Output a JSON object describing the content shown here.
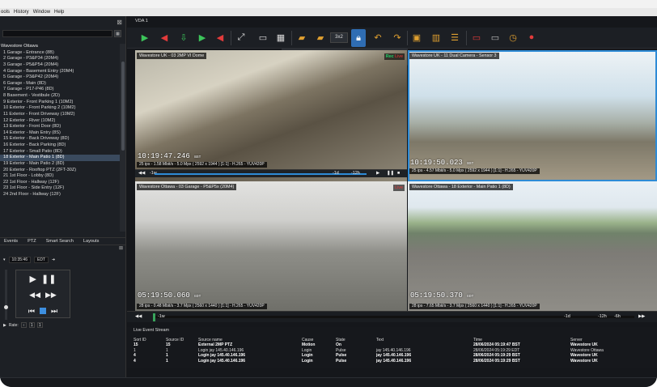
{
  "app": {
    "menu": [
      "ools",
      "History",
      "Window",
      "Help"
    ]
  },
  "left_panel": {
    "close_glyph": "⊠",
    "tree": {
      "root": "Wavestore Ottawa",
      "items": [
        "1 Garage - Entrance (8B)",
        "2 Garage - P3&P34 (20M4)",
        "3 Garage - P5&P54 (20M4)",
        "4 Garage - Basement Entry (20M4)",
        "5 Garage - P3&P42 (20M4)",
        "6 Garage - Main (8D)",
        "7 Garage - P17-P46 (8D)",
        "8 Basement - Vestibule (2D)",
        "9 Exterior - Front Parking 1 (10M2)",
        "10 Exterior - Front Parking 2 (10M2)",
        "11 Exterior - Front Driveway (10M2)",
        "12 Exterior - River (10M2)",
        "13 Exterior - Front Door (8D)",
        "14 Exterior - Main Entry (8S)",
        "15 Exterior - Back Driveway (8D)",
        "16 Exterior - Back Parking (8D)",
        "17 Exterior - Small Patio (8D)",
        "18 Exterior - Main Patio 1 (8D)",
        "19 Exterior - Main Patio 2 (8D)",
        "20 Exterior - Rooftop PTZ (2FT-30Z)",
        "21 1st Floor - Lobby (8D)",
        "22 1st Floor - Hallway (12F)",
        "23 1st Floor - Side Entry (12F)",
        "24 2nd Floor - Hallway (12F)"
      ],
      "selected_index": 17
    },
    "tabs": [
      "Events",
      "PTZ",
      "Smart Search",
      "Layouts"
    ],
    "playback": {
      "time": "10:35:46",
      "zone": "EDT",
      "rate_label": "Rate:",
      "rate_values": [
        "1",
        "1"
      ]
    }
  },
  "main": {
    "view_tab": "VDA 1",
    "grid_selector": "3x2",
    "tiles": [
      {
        "label": "Wavestore UK - 03 2MP VI Dome",
        "time": "10:19:47.246",
        "tz": "BST",
        "info": "25 ips - 1.58 Mbit/s - 5.0 Mpx ( 2592 x 1944 ) [1:1] - H.265 - YUV420P",
        "badge_rec": "Rec",
        "badge_live": "Live",
        "scrub_left": "-1w",
        "scrub_mid": "-1d",
        "scrub_right": "-12h"
      },
      {
        "label": "Wavestore UK - 11 Dual Camera - Sensor 3",
        "time": "10:19:50.023",
        "tz": "BST",
        "info": "25 ips - 4.57 Mbit/s - 5.0 Mpx ( 2592 x 1944 ) [1:1] - H.265 - YUV420P"
      },
      {
        "label": "Wavestore Ottawa - 03 Garage - P5&P5x (20M4)",
        "time": "05:19:50.060",
        "tz": "EDT",
        "info": "28 ips - 0.48 Mbit/s - 3.7 Mpx ( 2560 x 1440 ) [1:1] - H.265 - YUV420P",
        "badge_live": "Live"
      },
      {
        "label": "Wavestore Ottawa - 18 Exterior - Main Patio 1 (8D)",
        "time": "05:19:50.370",
        "tz": "EDT",
        "info": "28 ips - 7.65 Mbit/s - 3.7 Mpx ( 2560 x 1440 ) [1:1] - H.265 - YUV420P"
      }
    ],
    "timeline": {
      "left": "-1w",
      "mid": "-1d",
      "mid2": "-12h",
      "right": "-6h"
    }
  },
  "events": {
    "title": "Live Event Stream",
    "columns": [
      "Sort ID",
      "Source ID",
      "Source name",
      "Cause",
      "State",
      "Text",
      "Time",
      "Server"
    ],
    "rows": [
      [
        "15",
        "15",
        "External 2MP PTZ",
        "Motion",
        "On",
        "",
        "28/06/2024 05:19:47 BST",
        "Wavestore UK"
      ],
      [
        "1",
        "1",
        "Login jay 145.40.146.196",
        "Login",
        "Pulse",
        "jay 145.40.146.196",
        "28/06/2024 05:19:29 EDT",
        "Wavestore Ottawa"
      ],
      [
        "4",
        "1",
        "Login jay 145.40.146.196",
        "Login",
        "Pulse",
        "jay 145.40.146.196",
        "28/06/2024 05:19:29 BST",
        "Wavestore UK"
      ],
      [
        "4",
        "1",
        "Login jay 145.40.146.196",
        "Login",
        "Pulse",
        "jay 145.40.146.196",
        "28/06/2024 05:19:29 BST",
        "Wavestore UK"
      ]
    ],
    "bold_rows": [
      0,
      2,
      3
    ]
  }
}
